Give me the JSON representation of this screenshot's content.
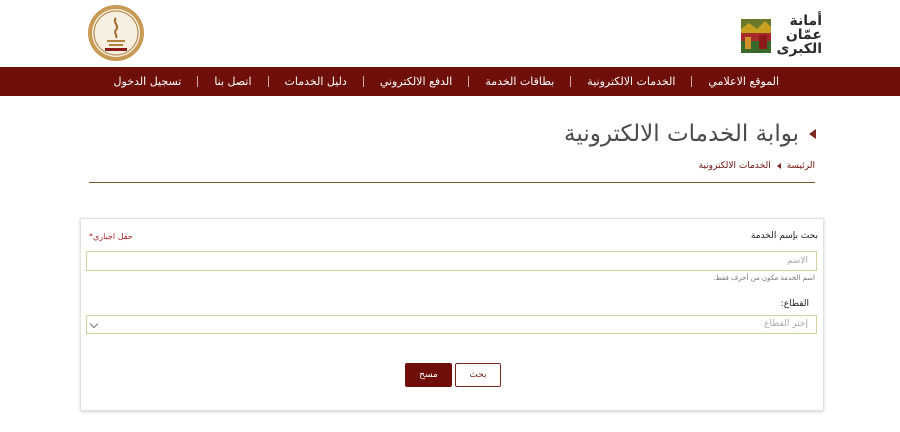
{
  "header": {
    "logo_right": {
      "line1": "أمانة",
      "line2": "عمّان",
      "line3": "الكبرى"
    },
    "logo_left_alt": "seal-of-excellence",
    "nav": [
      {
        "label": "الموقع الاعلامي"
      },
      {
        "label": "الخدمات الالكترونية"
      },
      {
        "label": "بطاقات الخدمة"
      },
      {
        "label": "الدفع الالكتروني"
      },
      {
        "label": "دليل الخدمات"
      },
      {
        "label": "اتصل بنا"
      },
      {
        "label": "تسجيل الدخول"
      }
    ]
  },
  "page": {
    "title": "بوابة الخدمات الالكترونية",
    "breadcrumb": [
      "الرئيسة",
      "الخدمات الالكترونية"
    ]
  },
  "form": {
    "search_label": "بحث بإسم الخدمة",
    "required_note": "حقل اجباري*",
    "name_placeholder": "الاسم",
    "name_hint": "اسم الخدمة مكون من أحرف فقط.",
    "sector_label": "القطاع:",
    "sector_placeholder": "إختر القطاع",
    "search_button": "بحث",
    "clear_button": "مسح"
  },
  "colors": {
    "primary": "#6e0f0a",
    "accent": "#b22222",
    "rule": "#7a5a30"
  }
}
